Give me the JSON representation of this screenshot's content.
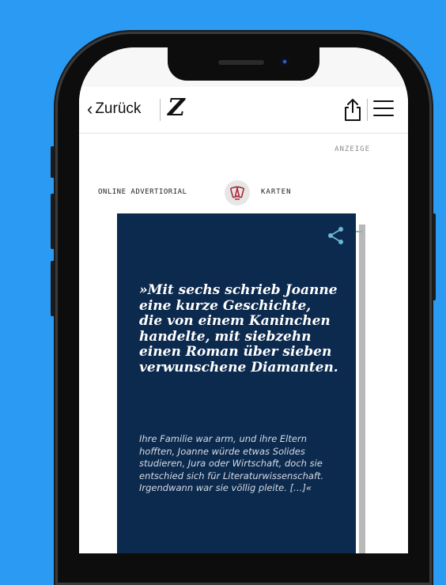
{
  "topbar": {
    "back_label": "Zurück",
    "logo": "Z"
  },
  "ad": {
    "label": "ANZEIGE",
    "left_label": "ONLINE ADVERTIORIAL",
    "right_label": "KARTEN"
  },
  "card": {
    "quote": "»Mit sechs schrieb Joanne eine kurze Geschichte, die von einem Kaninchen handelte, mit siebzehn einen Roman über sieben verwunschene Diamanten.",
    "body": "Ihre Familie war arm, und ihre Eltern hofften, Joanne würde etwas Solides studieren, Jura oder Wirtschaft, doch sie entschied sich für Literaturwissenschaft. Irgendwann war sie völlig pleite. […]«"
  },
  "colors": {
    "background": "#2b9af3",
    "card": "#0c2a4e",
    "share_accent": "#6ab8d4"
  }
}
